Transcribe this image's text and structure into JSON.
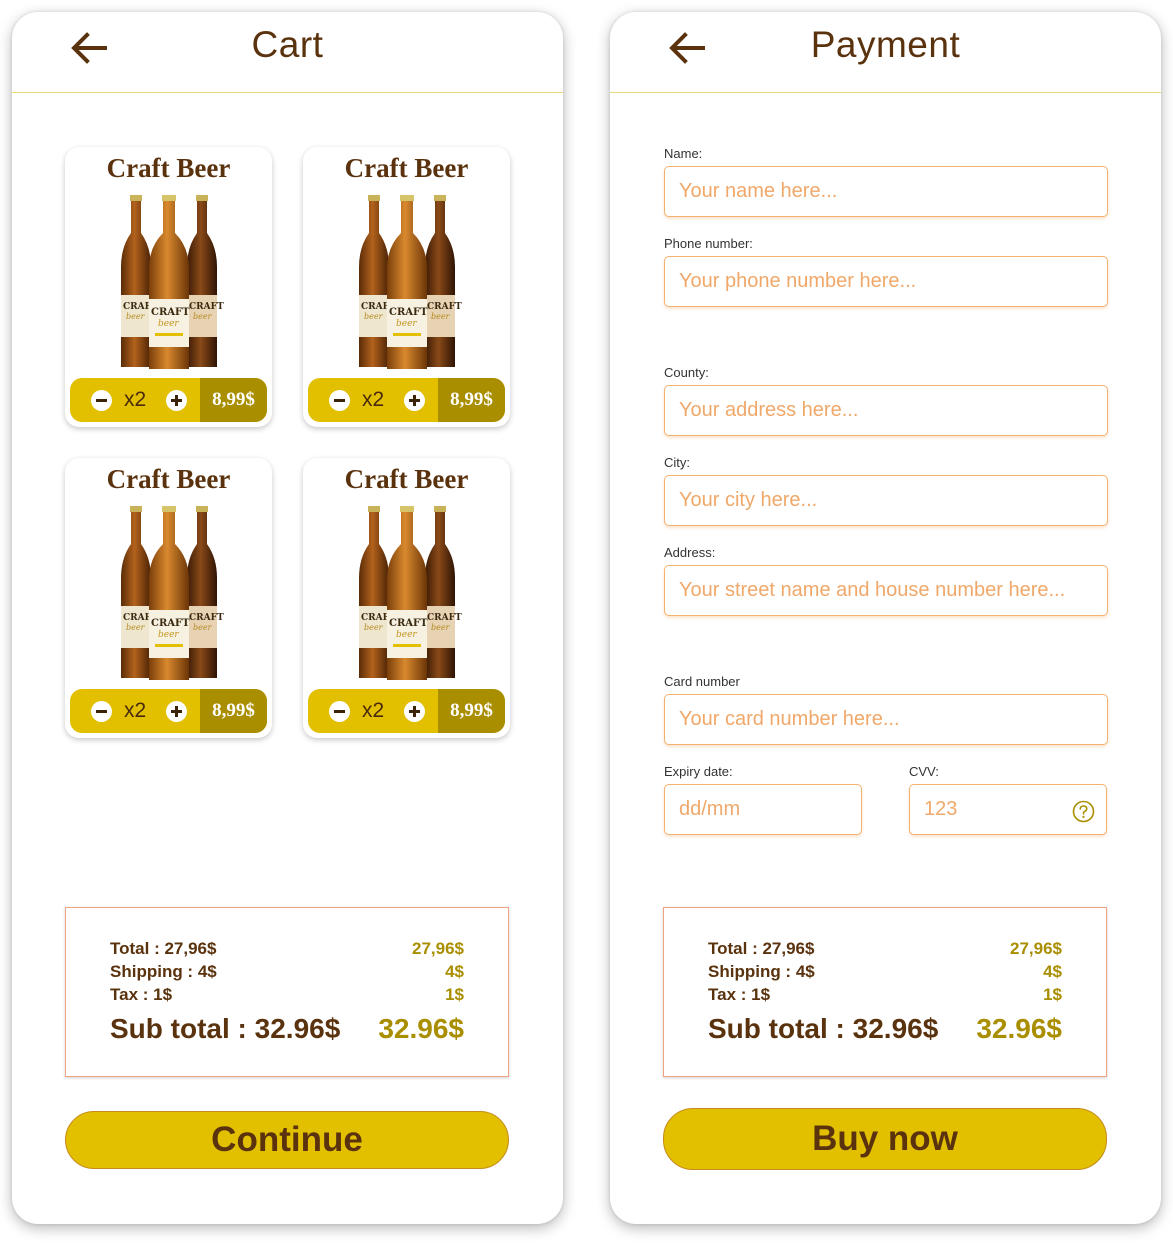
{
  "colors": {
    "brown": "#5a330e",
    "gold": "#e2c000",
    "dark_gold": "#a98e00",
    "peach_border": "#f4b06f"
  },
  "cart": {
    "back_icon": "arrow-left-icon",
    "title": "Cart",
    "products": [
      {
        "name": "Craft Beer",
        "quantity": "x2",
        "price": "8,99$"
      },
      {
        "name": "Craft Beer",
        "quantity": "x2",
        "price": "8,99$"
      },
      {
        "name": "Craft Beer",
        "quantity": "x2",
        "price": "8,99$"
      },
      {
        "name": "Craft Beer",
        "quantity": "x2",
        "price": "8,99$"
      }
    ],
    "summary": {
      "total_label": "Total : 27,96$",
      "total_value": "27,96$",
      "shipping_label": "Shipping : 4$",
      "shipping_value": "4$",
      "tax_label": "Tax : 1$",
      "tax_value": "1$",
      "subtotal_label": "Sub total : 32.96$",
      "subtotal_value": "32.96$"
    },
    "continue_label": "Continue"
  },
  "payment": {
    "back_icon": "arrow-left-icon",
    "title": "Payment",
    "name_label": "Name:",
    "name_placeholder": "Your name here...",
    "phone_label": "Phone number:",
    "phone_placeholder": "Your phone number here...",
    "county_label": "County:",
    "county_placeholder": "Your address here...",
    "city_label": "City:",
    "city_placeholder": "Your city here...",
    "address_label": "Address:",
    "address_placeholder": "Your street name and house number here...",
    "card_label": "Card number",
    "card_placeholder": "Your card number here...",
    "expiry_label": "Expiry date:",
    "expiry_placeholder": "dd/mm",
    "cvv_label": "CVV:",
    "cvv_placeholder": "123",
    "summary": {
      "total_label": "Total : 27,96$",
      "total_value": "27,96$",
      "shipping_label": "Shipping : 4$",
      "shipping_value": "4$",
      "tax_label": "Tax : 1$",
      "tax_value": "1$",
      "subtotal_label": "Sub total : 32.96$",
      "subtotal_value": "32.96$"
    },
    "buy_label": "Buy now"
  }
}
